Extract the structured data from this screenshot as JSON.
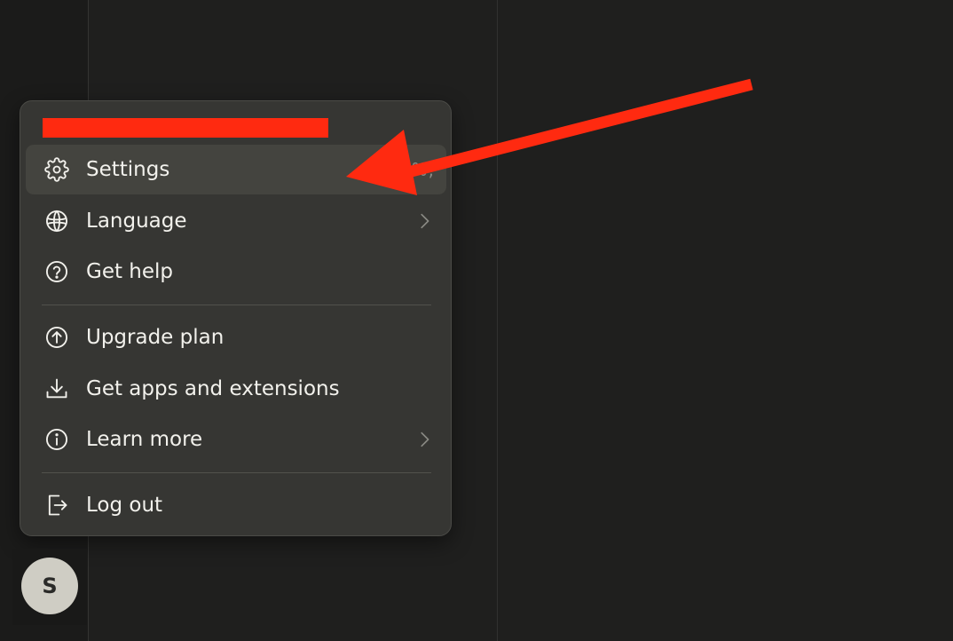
{
  "menu": {
    "email_text": "",
    "items": [
      {
        "label": "Settings",
        "shortcut": "⌘,",
        "icon": "gear-icon"
      },
      {
        "label": "Language",
        "icon": "globe-icon",
        "has_submenu": true
      },
      {
        "label": "Get help",
        "icon": "help-circle-icon"
      },
      {
        "label": "Upgrade plan",
        "icon": "arrow-up-circle-icon"
      },
      {
        "label": "Get apps and extensions",
        "icon": "download-icon"
      },
      {
        "label": "Learn more",
        "icon": "info-circle-icon",
        "has_submenu": true
      },
      {
        "label": "Log out",
        "icon": "logout-icon"
      }
    ]
  },
  "avatar": {
    "initial": "S"
  },
  "annotation": {
    "arrow_color": "#ff2a10"
  },
  "colors": {
    "background": "#1f1f1e",
    "menu_background": "#363633",
    "active_item": "#44443f",
    "text": "#f2f1ec",
    "redaction": "#ff2a10"
  }
}
